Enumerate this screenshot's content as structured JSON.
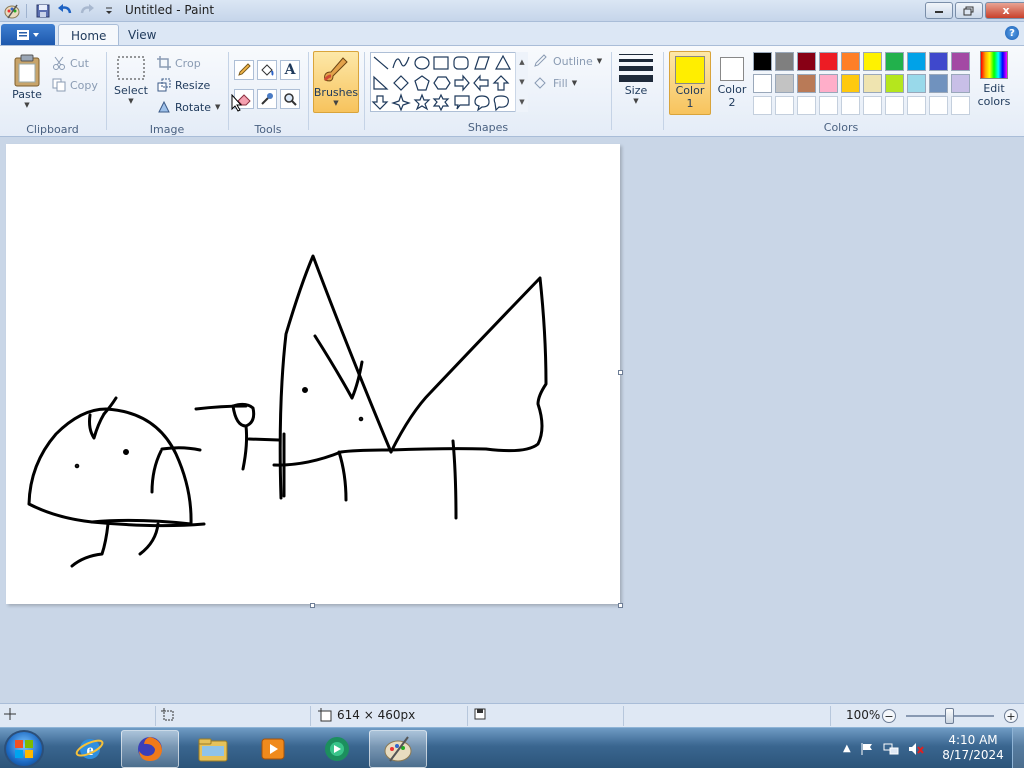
{
  "window": {
    "title": "Untitled - Paint",
    "close_label": "x"
  },
  "tabs": {
    "home": "Home",
    "view": "View",
    "help_label": "?"
  },
  "clipboard": {
    "paste": "Paste",
    "cut": "Cut",
    "copy": "Copy",
    "group": "Clipboard"
  },
  "image": {
    "select": "Select",
    "crop": "Crop",
    "resize": "Resize",
    "rotate": "Rotate",
    "group": "Image"
  },
  "tools": {
    "group": "Tools",
    "text_tool": "A"
  },
  "brushes": {
    "label": "Brushes"
  },
  "shapes": {
    "outline": "Outline",
    "fill": "Fill",
    "group": "Shapes"
  },
  "size": {
    "label": "Size"
  },
  "colors": {
    "color1_line1": "Color",
    "color1_line2": "1",
    "color2_line1": "Color",
    "color2_line2": "2",
    "edit_line1": "Edit",
    "edit_line2": "colors",
    "group": "Colors",
    "color1_value": "#ffee00",
    "color2_value": "#ffffff",
    "palette_row1": [
      "#000000",
      "#7f7f7f",
      "#880015",
      "#ed1c24",
      "#ff7f27",
      "#fff200",
      "#22b14c",
      "#00a2e8",
      "#3f48cc",
      "#a349a4"
    ],
    "palette_row2": [
      "#ffffff",
      "#c3c3c3",
      "#b97a57",
      "#ffaec9",
      "#ffc90e",
      "#efe4b0",
      "#b5e61d",
      "#99d9ea",
      "#7092be",
      "#c8bfe7"
    ]
  },
  "status": {
    "canvas_size": "614 × 460px",
    "zoom": "100%",
    "zoom_minus": "−",
    "zoom_plus": "+"
  },
  "taskbar": {
    "time": "4:10 AM",
    "date": "8/17/2024"
  }
}
